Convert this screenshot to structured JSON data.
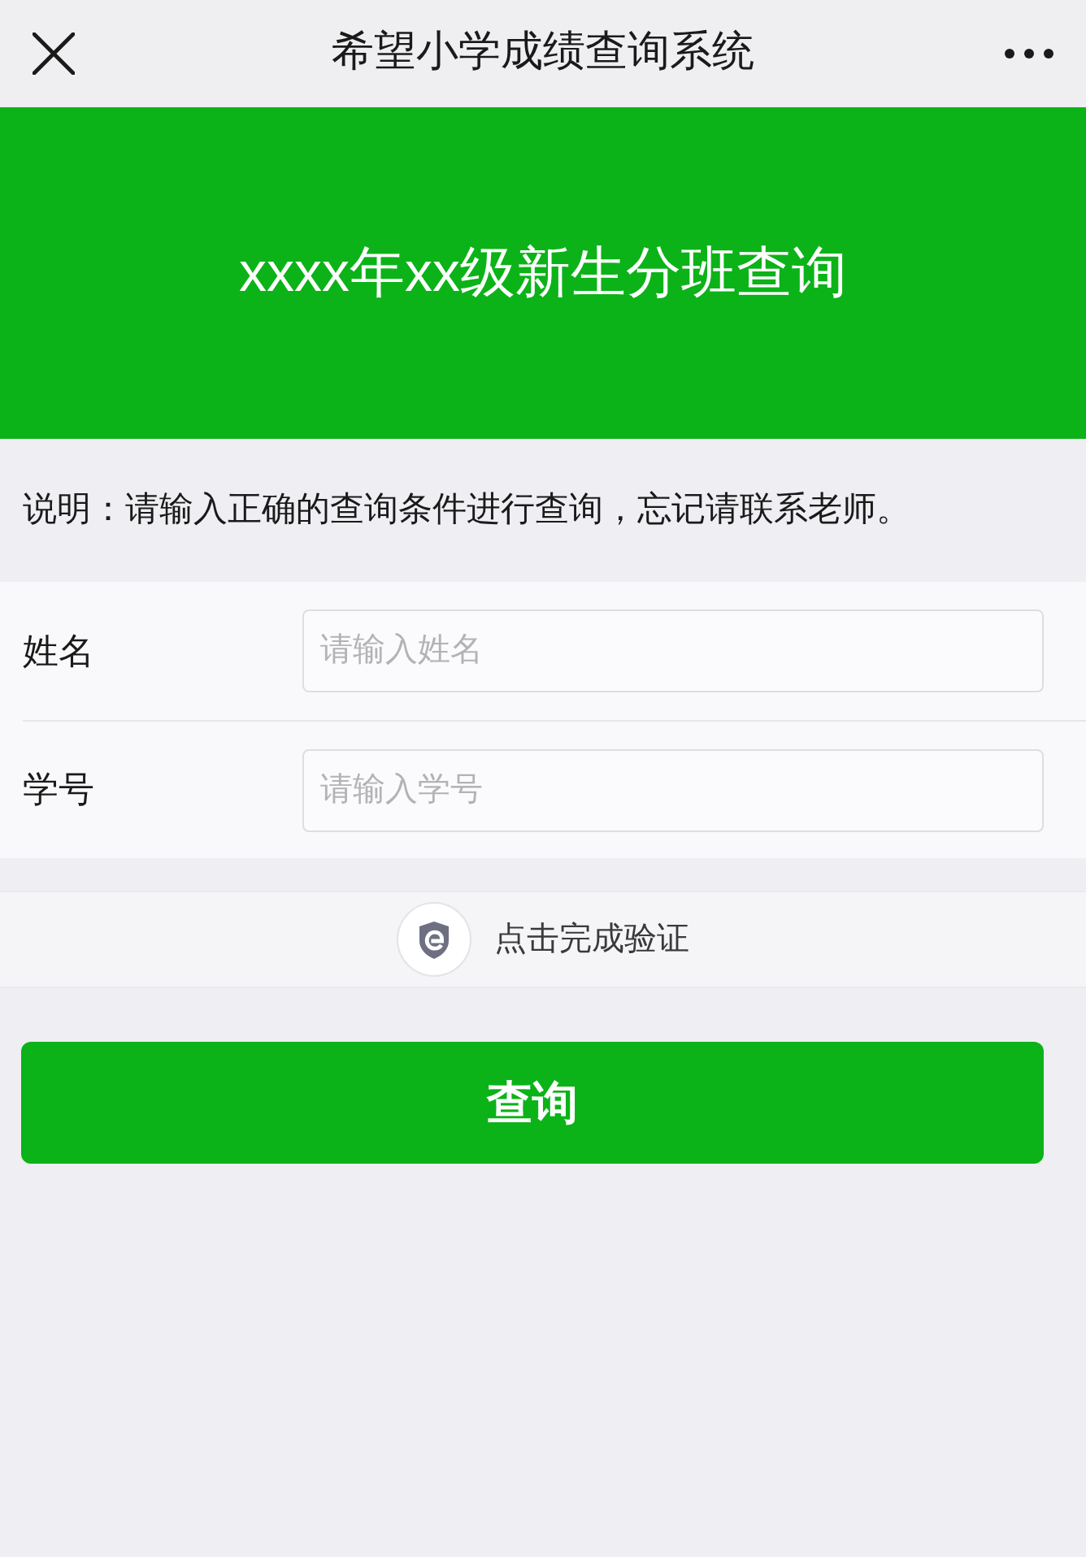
{
  "nav_bar": {
    "title": "希望小学成绩查询系统"
  },
  "banner": {
    "title": "xxxx年xx级新生分班查询"
  },
  "notice": "说明：请输入正确的查询条件进行查询，忘记请联系老师。",
  "form": {
    "fields": [
      {
        "label": "姓名",
        "placeholder": "请输入姓名"
      },
      {
        "label": "学号",
        "placeholder": "请输入学号"
      }
    ]
  },
  "verification": {
    "label": "点击完成验证"
  },
  "submit_button": {
    "label": "查询"
  }
}
